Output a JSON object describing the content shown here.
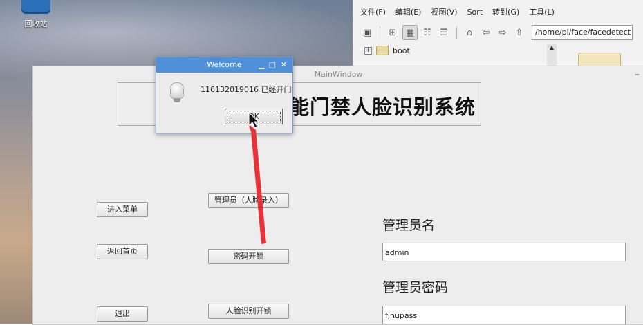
{
  "desktop": {
    "trash_label": "回收站"
  },
  "file_manager": {
    "menu": [
      "文件(F)",
      "编辑(E)",
      "视图(V)",
      "Sort",
      "转到(G)",
      "工具(L)"
    ],
    "path": "/home/pi/face/facedetect",
    "tree_item": "boot",
    "expander": "+"
  },
  "main_window": {
    "title": "MainWindow",
    "minimize": "–",
    "heading": "能门禁人脸识别系统",
    "buttons": {
      "enter_menu": "进入菜单",
      "back_home": "返回首页",
      "exit": "退出",
      "admin_face": "管理员（人脸录入）",
      "password_unlock": "密码开锁",
      "face_unlock": "人脸识别开锁"
    },
    "admin_name_label": "管理员名",
    "admin_name_value": "admin",
    "admin_password_label": "管理员密码",
    "admin_password_value": "fjnupass"
  },
  "dialog": {
    "title": "Welcome",
    "message": "116132019016 已经开门",
    "ok": "OK",
    "controls": {
      "minimize": "▁",
      "maximize": "□",
      "close": "✕"
    }
  },
  "colors": {
    "dialog_title": "#4f90d9",
    "annotation_arrow": "#e8323a"
  }
}
